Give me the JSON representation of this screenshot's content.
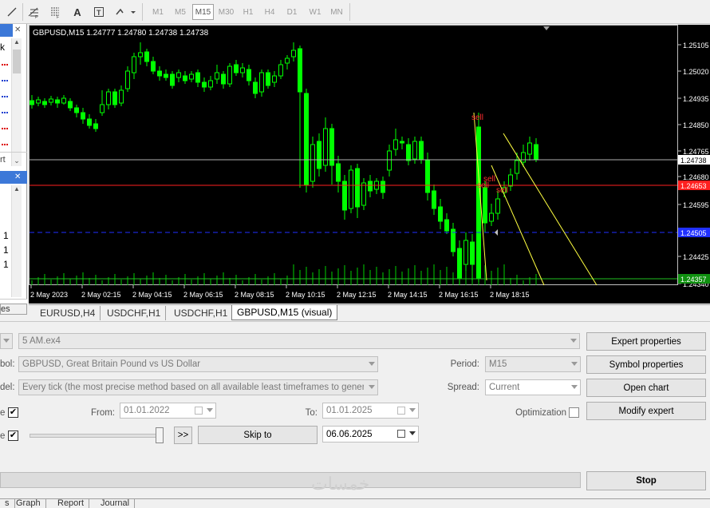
{
  "toolbar": {
    "icons": [
      "line-tool-icon",
      "fibonacci-icon",
      "fibo-expansion-icon",
      "text-icon",
      "text-label-icon",
      "arrows-icon"
    ],
    "text_label": "A",
    "timeframes": [
      "M1",
      "M5",
      "M15",
      "M30",
      "H1",
      "H4",
      "D1",
      "W1",
      "MN"
    ],
    "active_timeframe": "M15"
  },
  "left_panel": {
    "top_k": "k",
    "mid_text": "rt",
    "numbers": [
      "1",
      "1",
      "1"
    ],
    "bottom_text": "es"
  },
  "chart": {
    "info": "GBPUSD,M15  1.24777 1.24780 1.24738 1.24738",
    "price_labels": [
      "1.25105",
      "1.25020",
      "1.24935",
      "1.24850",
      "1.24765",
      "1.24680",
      "1.24595",
      "1.24425",
      "1.24340"
    ],
    "current_price": "1.24738",
    "red_price": "1.24653",
    "blue_price": "1.24505",
    "green_price": "1.24357",
    "time_labels": [
      "2 May 2023",
      "2 May 02:15",
      "2 May 04:15",
      "2 May 06:15",
      "2 May 08:15",
      "2 May 10:15",
      "2 May 12:15",
      "2 May 14:15",
      "2 May 16:15",
      "2 May 18:15"
    ],
    "sell_labels": [
      "sell",
      "sell",
      "sell",
      "sell"
    ],
    "colors": {
      "bull": "#00ff00",
      "bear": "#00ff00",
      "red_line": "#ff0000",
      "blue_line": "#0000ff",
      "trend": "#ffff00"
    }
  },
  "chart_tabs": [
    "EURUSD,H4",
    "USDCHF,H1",
    "USDCHF,H1",
    "GBPUSD,M15 (visual)"
  ],
  "tester": {
    "expert_value": "5 AM.ex4",
    "symbol_label": "bol:",
    "symbol_value": "GBPUSD, Great Britain Pound vs US Dollar",
    "model_label": "del:",
    "model_value": "Every tick (the most precise method based on all available least timeframes to generate eac",
    "use_date_label": "e",
    "visual_label": "e",
    "from_label": "From:",
    "from_value": "01.01.2022",
    "to_label": "To:",
    "to_value": "01.01.2025",
    "period_label": "Period:",
    "period_value": "M15",
    "spread_label": "Spread:",
    "spread_value": "Current",
    "optimization_label": "Optimization",
    "skip_button": ">>",
    "skip_to": "Skip to",
    "skip_date": "06.06.2025",
    "buttons": {
      "expert_properties": "Expert properties",
      "symbol_properties": "Symbol properties",
      "open_chart": "Open chart",
      "modify_expert": "Modify expert",
      "stop": "Stop"
    },
    "watermark": "خمسات"
  },
  "bottom_tabs": [
    "s",
    "Graph",
    "Report",
    "Journal"
  ]
}
